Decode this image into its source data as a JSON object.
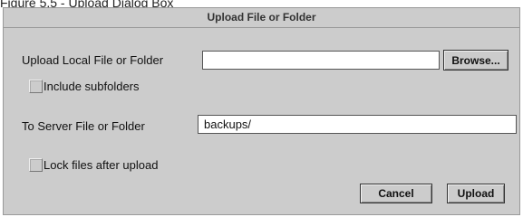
{
  "caption": "Figure 5.5 - Upload Dialog Box",
  "dialog": {
    "title": "Upload File or Folder",
    "local": {
      "label": "Upload Local File or Folder",
      "value": "",
      "browse_label": "Browse..."
    },
    "include_subfolders": {
      "label": "Include subfolders",
      "checked": false
    },
    "server": {
      "label": "To Server File or Folder",
      "value": "backups/"
    },
    "lock_files": {
      "label": "Lock files after upload",
      "checked": false
    },
    "buttons": {
      "cancel": "Cancel",
      "upload": "Upload"
    }
  }
}
